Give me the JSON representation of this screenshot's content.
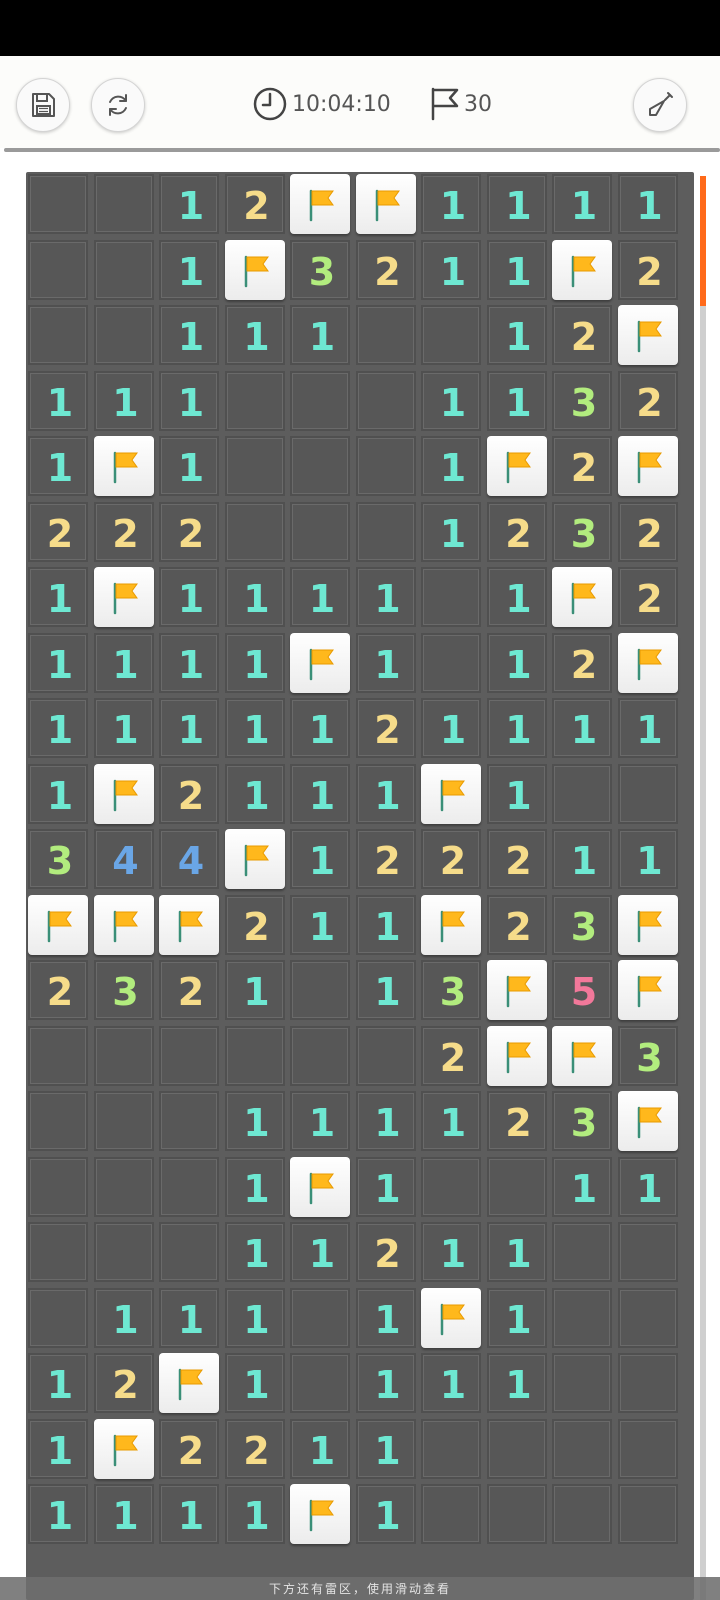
{
  "header": {
    "timer": "10:04:10",
    "flags_remaining": "30",
    "icons": {
      "save": "save-icon",
      "restart": "restart-icon",
      "clock": "clock-icon",
      "flag": "flag-counter-icon",
      "shovel": "shovel-icon"
    }
  },
  "board": {
    "columns": 10,
    "visible_rows": 21,
    "legend": "F = flagged cell, 0 = opened empty cell, digit = adjacent mine count, ' ' = not visible",
    "rows": [
      "0012FF1111",
      "001F3211F2",
      "001110012F",
      "1110001132",
      "1F10001F2F",
      "2220001232",
      "1F11110F2",
      "1111F101",
      "1111121111",
      "1F21111F10",
      "344F122211",
      "FFF211F23F",
      "23210013F5",
      "000000 2FF3",
      "0001111 23F",
      "0001F1 0011",
      "0001121100",
      "0111010F10",
      "12F1011100",
      "1F22110000",
      "1111F10000"
    ],
    "grid": [
      [
        "0",
        "0",
        "1",
        "2",
        "F",
        "F",
        "1",
        "1",
        "1",
        "1"
      ],
      [
        "0",
        "0",
        "1",
        "F",
        "3",
        "2",
        "1",
        "1",
        "F",
        "2"
      ],
      [
        "0",
        "0",
        "1",
        "1",
        "1",
        "0",
        "0",
        "1",
        "2",
        "F"
      ],
      [
        "1",
        "1",
        "1",
        "0",
        "0",
        "0",
        "1",
        "1",
        "3",
        "2"
      ],
      [
        "1",
        "F",
        "1",
        "0",
        "0",
        "0",
        "1",
        "F",
        "2",
        "F"
      ],
      [
        "2",
        "2",
        "2",
        "0",
        "0",
        "0",
        "1",
        "2",
        "3",
        "2"
      ],
      [
        "1",
        "F",
        "1",
        "1",
        "1",
        "1",
        "0",
        "1",
        "F",
        "2"
      ],
      [
        "1",
        "1",
        "1",
        "1",
        "F",
        "1",
        "0",
        "1",
        "2",
        "F"
      ],
      [
        "1",
        "1",
        "1",
        "1",
        "1",
        "2",
        "1",
        "1",
        "1",
        "1"
      ],
      [
        "1",
        "F",
        "2",
        "1",
        "1",
        "1",
        "F",
        "1",
        "0",
        "0"
      ],
      [
        "3",
        "4",
        "4",
        "F",
        "1",
        "2",
        "2",
        "2",
        "1",
        "1"
      ],
      [
        "F",
        "F",
        "F",
        "2",
        "1",
        "1",
        "F",
        "2",
        "3",
        "F"
      ],
      [
        "2",
        "3",
        "2",
        "1",
        "0",
        "1",
        "3",
        "F",
        "5",
        "F"
      ],
      [
        "0",
        "0",
        "0",
        "0",
        "0",
        "0",
        "2",
        "F",
        "F",
        "3"
      ],
      [
        "0",
        "0",
        "0",
        "1",
        "1",
        "1",
        "1",
        "2",
        "3",
        "F"
      ],
      [
        "0",
        "0",
        "0",
        "1",
        "F",
        "1",
        "0",
        "0",
        "1",
        "1"
      ],
      [
        "0",
        "0",
        "0",
        "1",
        "1",
        "2",
        "1",
        "1",
        "0",
        "0"
      ],
      [
        "0",
        "1",
        "1",
        "1",
        "0",
        "1",
        "F",
        "1",
        "0",
        "0"
      ],
      [
        "1",
        "2",
        "F",
        "1",
        "0",
        "1",
        "1",
        "1",
        "0",
        "0"
      ],
      [
        "1",
        "F",
        "2",
        "2",
        "1",
        "1",
        "0",
        "0",
        "0",
        "0"
      ],
      [
        "1",
        "1",
        "1",
        "1",
        "F",
        "1",
        "0",
        "0",
        "0",
        "0"
      ]
    ],
    "number_colors": {
      "1": "#6ee8d2",
      "2": "#f6dc8a",
      "3": "#b2ec7e",
      "4": "#6aa6e6",
      "5": "#f2789a"
    },
    "flag_color": "#ffb81c"
  },
  "hint_text": "下方还有雷区，使用滑动查看",
  "colors": {
    "board_bg": "#5d5d5d",
    "cell_open": "#575757",
    "scroll_thumb": "#ff6a1a"
  }
}
